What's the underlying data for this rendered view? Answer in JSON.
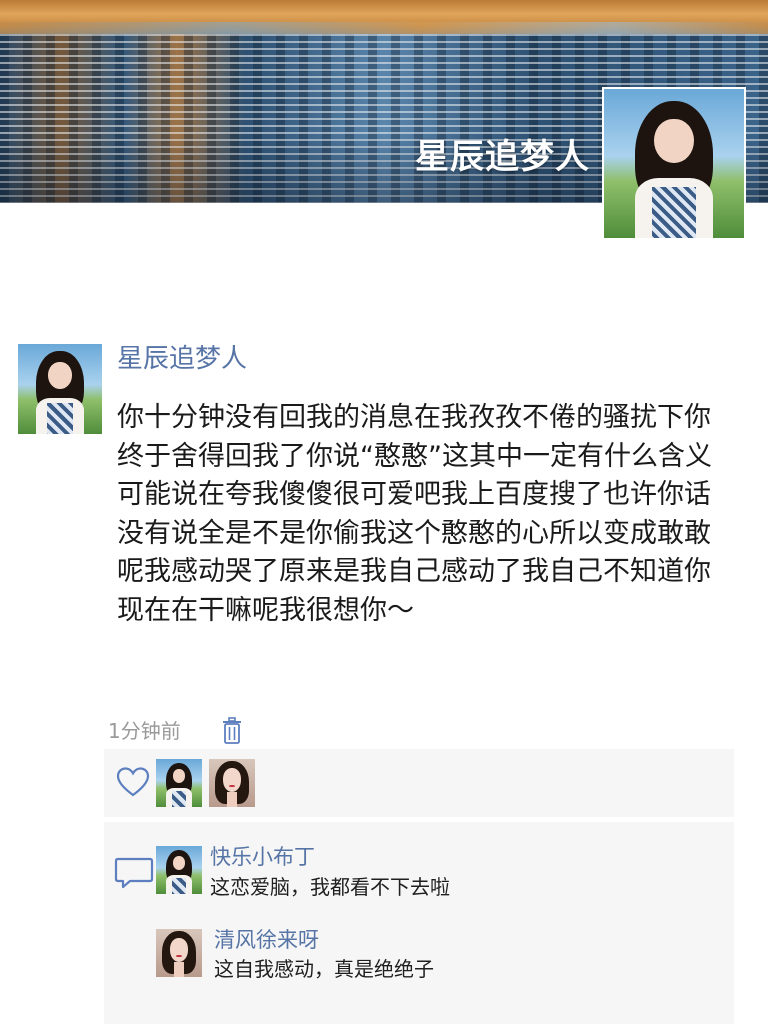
{
  "profile": {
    "cover_name": "星辰追梦人"
  },
  "post": {
    "author": "星辰追梦人",
    "text": "你十分钟没有回我的消息在我孜孜不倦的骚扰下你终于舍得回我了你说“憨憨”这其中一定有什么含义可能说在夸我傻傻很可爱吧我上百度搜了也许你话没有说全是不是你偷我这个憨憨的心所以变成敢敢呢我感动哭了原来是我自己感动了我自己不知道你现在在干嘛呢我很想你～",
    "time": "1分钟前",
    "delete_icon": "trash-icon"
  },
  "likes": {
    "icon": "heart-icon",
    "count": 2
  },
  "comments": [
    {
      "author": "快乐小布丁",
      "text": "这恋爱脑，我都看不下去啦"
    },
    {
      "author": "清风徐来呀",
      "text": "这自我感动，真是绝绝子"
    }
  ],
  "comments_icon": "comment-bubble-icon",
  "colors": {
    "link_blue": "#5774a6",
    "panel_gray": "#f6f6f6",
    "text_dark": "#1a1a1a",
    "time_gray": "#9a9a9a"
  }
}
